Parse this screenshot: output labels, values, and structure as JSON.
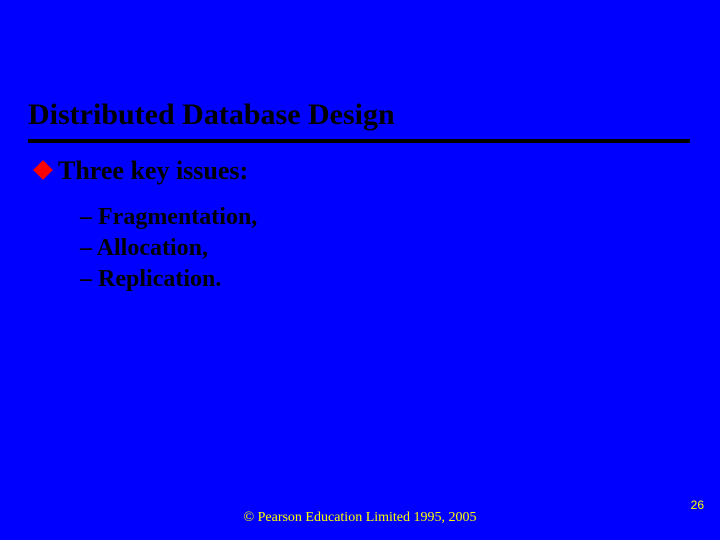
{
  "title": "Distributed Database Design",
  "bullet": "Three key issues:",
  "subitems": [
    "– Fragmentation,",
    "– Allocation,",
    "– Replication."
  ],
  "footer": "© Pearson Education Limited 1995, 2005",
  "pageNumber": "26"
}
